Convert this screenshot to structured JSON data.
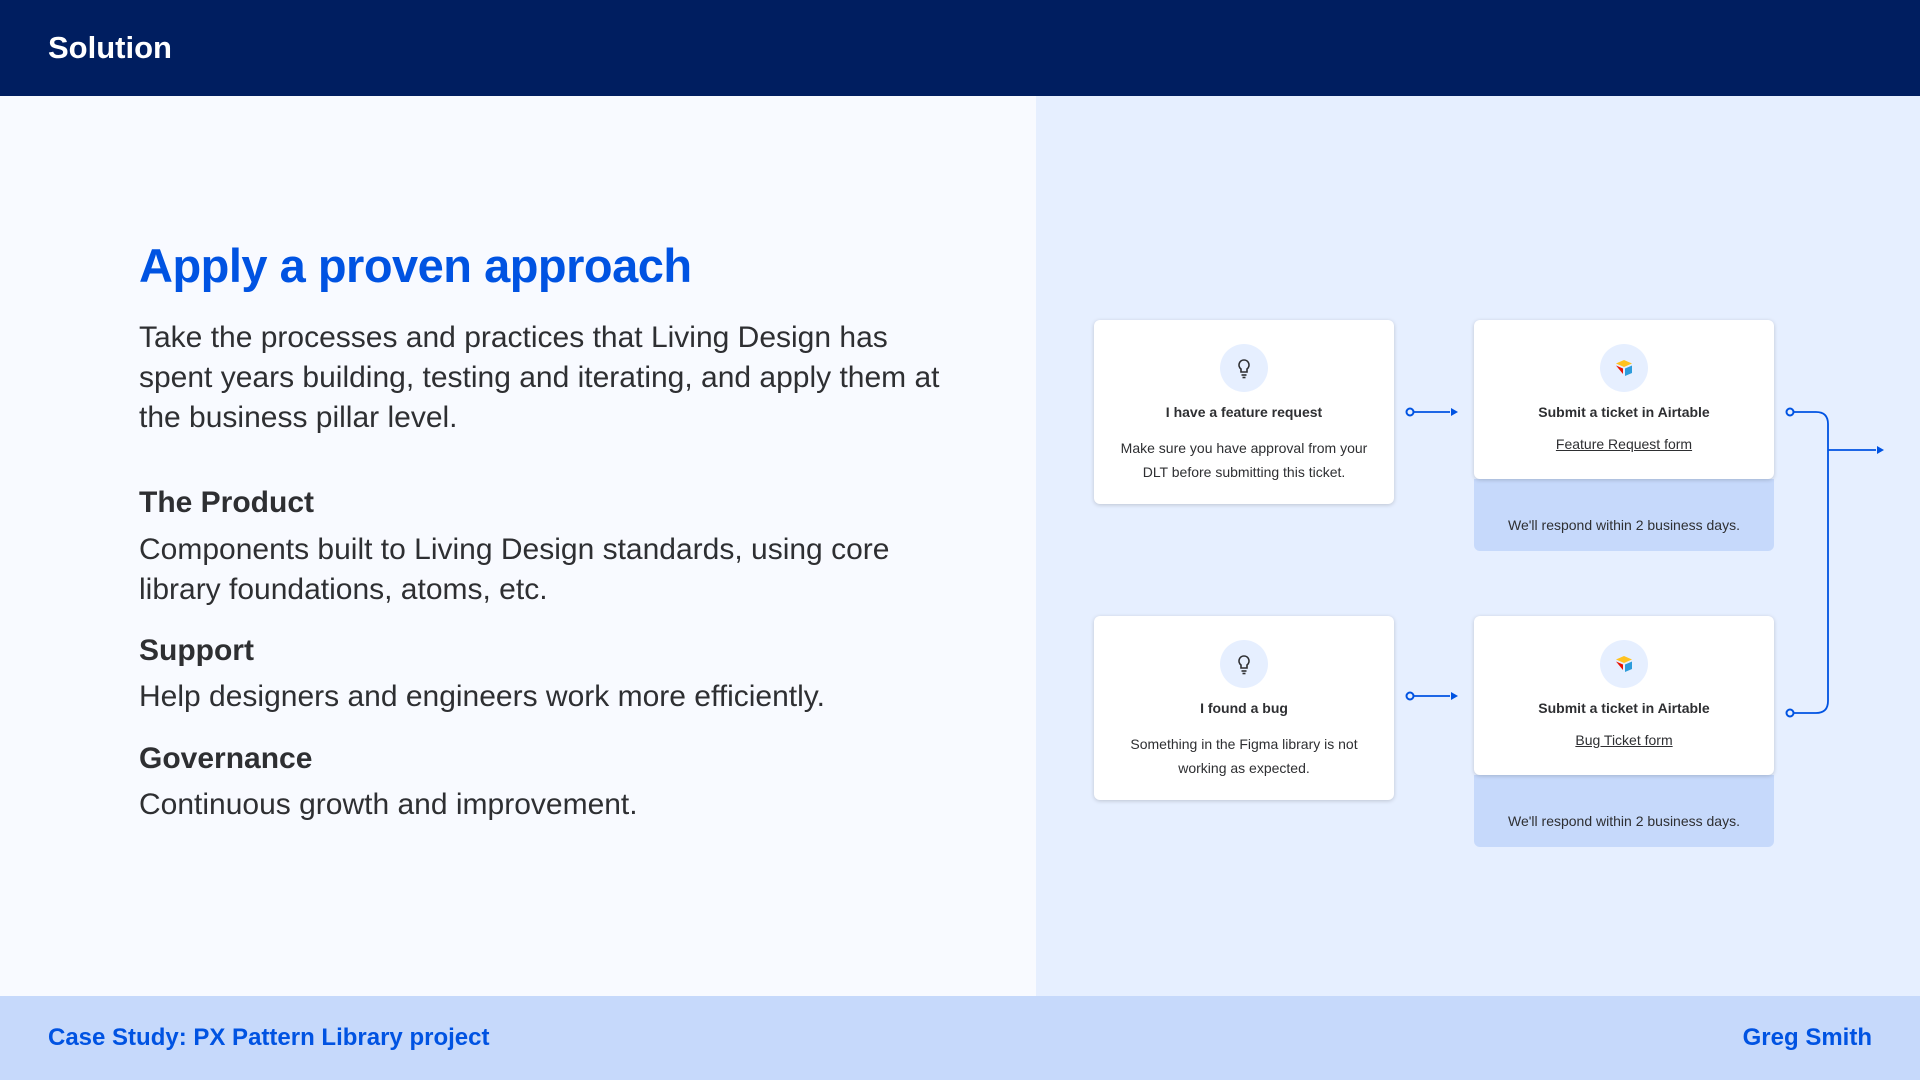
{
  "header": {
    "title": "Solution"
  },
  "main": {
    "heading": "Apply a proven approach",
    "intro": "Take the processes and practices that Living Design has spent years building, testing and iterating, and apply them at the business pillar level.",
    "sections": [
      {
        "title": "The Product",
        "body": "Components built to Living Design standards, using core library foundations, atoms, etc."
      },
      {
        "title": "Support",
        "body": "Help designers and engineers work more efficiently."
      },
      {
        "title": "Governance",
        "body": "Continuous growth and improvement."
      }
    ]
  },
  "flow": {
    "feature_card": {
      "icon": "lightbulb-icon",
      "title": "I have a feature request",
      "description": "Make sure you have approval from your DLT before submitting this ticket."
    },
    "feature_ticket": {
      "icon": "airtable-icon",
      "title": "Submit a ticket in Airtable",
      "link": "Feature Request form",
      "note": "We'll respond within 2 business days."
    },
    "bug_card": {
      "icon": "lightbulb-icon",
      "title": "I found a bug",
      "description": "Something in the Figma library is not working as expected."
    },
    "bug_ticket": {
      "icon": "airtable-icon",
      "title": "Submit a ticket in Airtable",
      "link": "Bug Ticket form",
      "note": "We'll respond within 2 business days."
    }
  },
  "footer": {
    "left": "Case Study: PX Pattern Library project",
    "right": "Greg Smith"
  },
  "colors": {
    "navy": "#001e60",
    "blue": "#0053e2",
    "light_blue": "#e6efff",
    "note_blue": "#c6d9fb"
  }
}
